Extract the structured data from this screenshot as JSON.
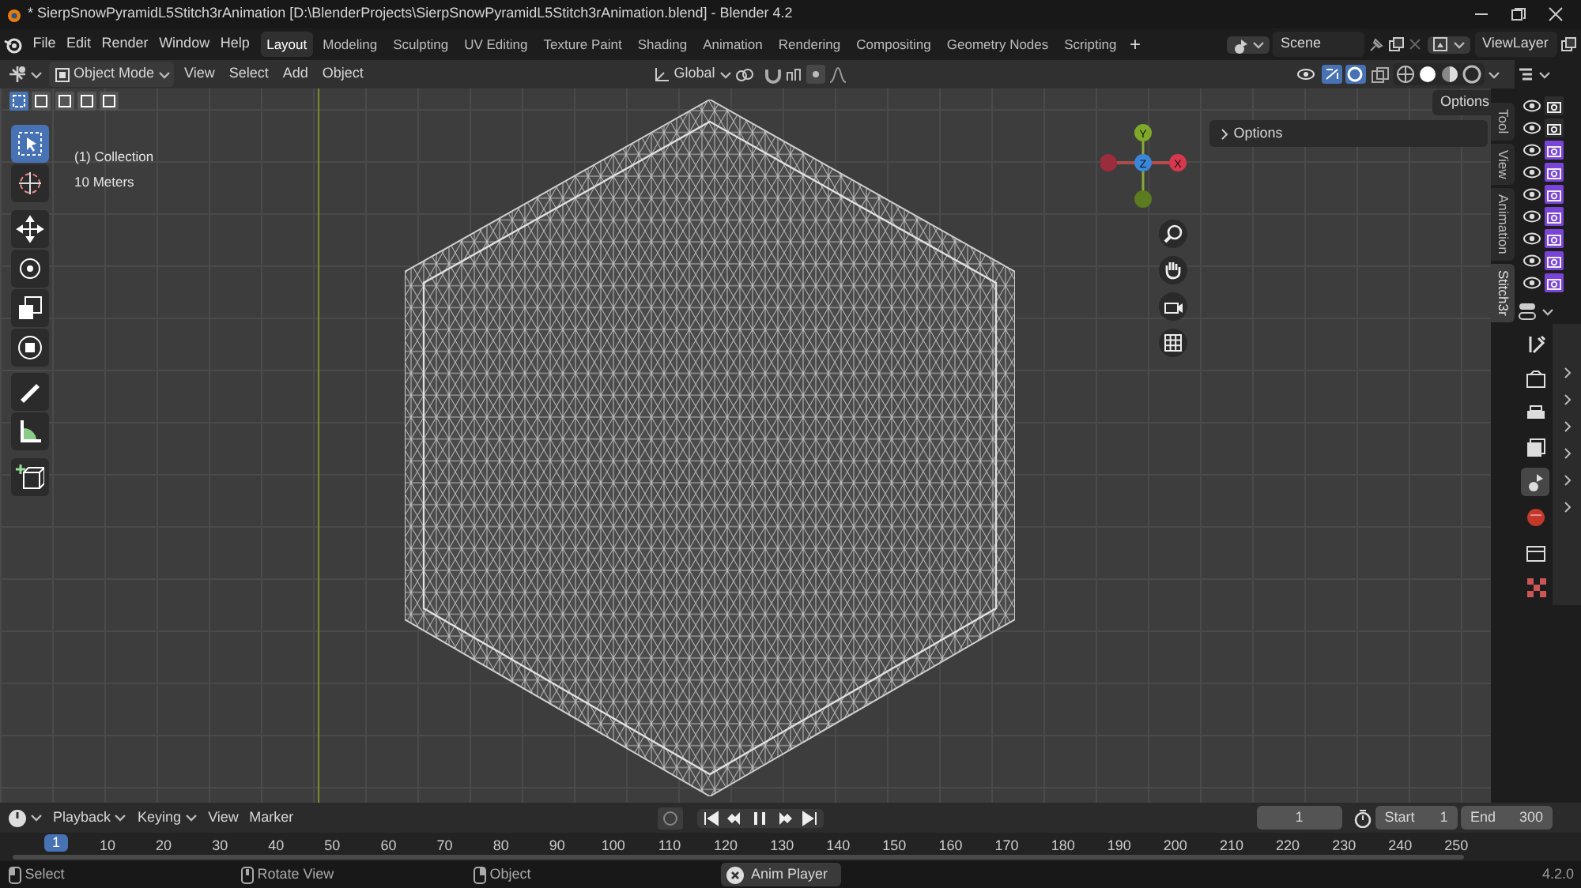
{
  "title_bar": {
    "title": "* SierpSnowPyramidL5Stitch3rAnimation [D:\\BlenderProjects\\SierpSnowPyramidL5Stitch3rAnimation.blend] - Blender 4.2"
  },
  "menu": [
    "File",
    "Edit",
    "Render",
    "Window",
    "Help"
  ],
  "workspace_tabs": [
    {
      "label": "Layout",
      "selected": true
    },
    {
      "label": "Modeling",
      "selected": false
    },
    {
      "label": "Sculpting",
      "selected": false
    },
    {
      "label": "UV Editing",
      "selected": false
    },
    {
      "label": "Texture Paint",
      "selected": false
    },
    {
      "label": "Shading",
      "selected": false
    },
    {
      "label": "Animation",
      "selected": false
    },
    {
      "label": "Rendering",
      "selected": false
    },
    {
      "label": "Compositing",
      "selected": false
    },
    {
      "label": "Geometry Nodes",
      "selected": false
    },
    {
      "label": "Scripting",
      "selected": false
    }
  ],
  "add_tab": "+",
  "scene": {
    "name": "Scene"
  },
  "view_layer": {
    "name": "ViewLayer"
  },
  "viewport_header": {
    "mode": "Object Mode",
    "menus": [
      "View",
      "Select",
      "Add",
      "Object"
    ],
    "orientation": "Global"
  },
  "select_modes": [
    {
      "selected": true
    },
    {
      "selected": false
    },
    {
      "selected": false
    },
    {
      "selected": false
    },
    {
      "selected": false
    }
  ],
  "toolbar": [
    {
      "tools": [
        {
          "kind": "select",
          "selected": true
        },
        {
          "kind": "cursor",
          "selected": false
        }
      ]
    },
    {
      "tools": [
        {
          "kind": "move",
          "selected": false
        },
        {
          "kind": "rotate",
          "selected": false
        },
        {
          "kind": "scale",
          "selected": false
        },
        {
          "kind": "transform",
          "selected": false
        }
      ]
    },
    {
      "tools": [
        {
          "kind": "annotate",
          "selected": false
        },
        {
          "kind": "measure",
          "selected": false
        }
      ]
    },
    {
      "tools": [
        {
          "kind": "add-cube",
          "selected": false
        }
      ]
    }
  ],
  "overlay_text": [
    "(1) Collection",
    "10 Meters"
  ],
  "options_button": "Options",
  "side_panel": {
    "section": "Options",
    "expanded": false
  },
  "side_tabs": [
    {
      "label": "Tool",
      "selected": false
    },
    {
      "label": "View",
      "selected": false
    },
    {
      "label": "Animation",
      "selected": false
    },
    {
      "label": "Stitch3r",
      "selected": true
    }
  ],
  "gizmo": {
    "axes": [
      "Y",
      "Z",
      "X"
    ]
  },
  "outliner_rows": [
    {
      "render_highlighted": false
    },
    {
      "render_highlighted": false
    },
    {
      "render_highlighted": true
    },
    {
      "render_highlighted": true
    },
    {
      "render_highlighted": true
    },
    {
      "render_highlighted": true
    },
    {
      "render_highlighted": true
    },
    {
      "render_highlighted": true
    },
    {
      "render_highlighted": true
    }
  ],
  "properties_tabs": [
    {
      "kind": "tool",
      "selected": false
    },
    {
      "kind": "render",
      "selected": false
    },
    {
      "kind": "output",
      "selected": false
    },
    {
      "kind": "view-layer",
      "selected": false
    },
    {
      "kind": "scene",
      "selected": true
    },
    {
      "kind": "world",
      "selected": false
    },
    {
      "kind": "collection",
      "selected": false
    },
    {
      "kind": "texture",
      "selected": false
    }
  ],
  "timeline": {
    "menus": [
      {
        "label": "Playback",
        "dropdown": true
      },
      {
        "label": "Keying",
        "dropdown": true
      },
      {
        "label": "View",
        "dropdown": false
      },
      {
        "label": "Marker",
        "dropdown": false
      }
    ],
    "current_frame": "1",
    "start_label": "Start",
    "start": "1",
    "end_label": "End",
    "end": "300",
    "playing": true,
    "frame_badge": "1",
    "ticks": [
      "10",
      "20",
      "30",
      "40",
      "50",
      "60",
      "70",
      "80",
      "90",
      "100",
      "110",
      "120",
      "130",
      "140",
      "150",
      "160",
      "170",
      "180",
      "190",
      "200",
      "210",
      "220",
      "230",
      "240",
      "250"
    ]
  },
  "status_bar": {
    "items": [
      {
        "kind": "mouse-left",
        "label": "Select"
      },
      {
        "kind": "mouse-middle",
        "label": "Rotate View"
      },
      {
        "kind": "mouse-right",
        "label": "Object"
      }
    ],
    "notice": "Anim Player",
    "version": "4.2.0"
  }
}
